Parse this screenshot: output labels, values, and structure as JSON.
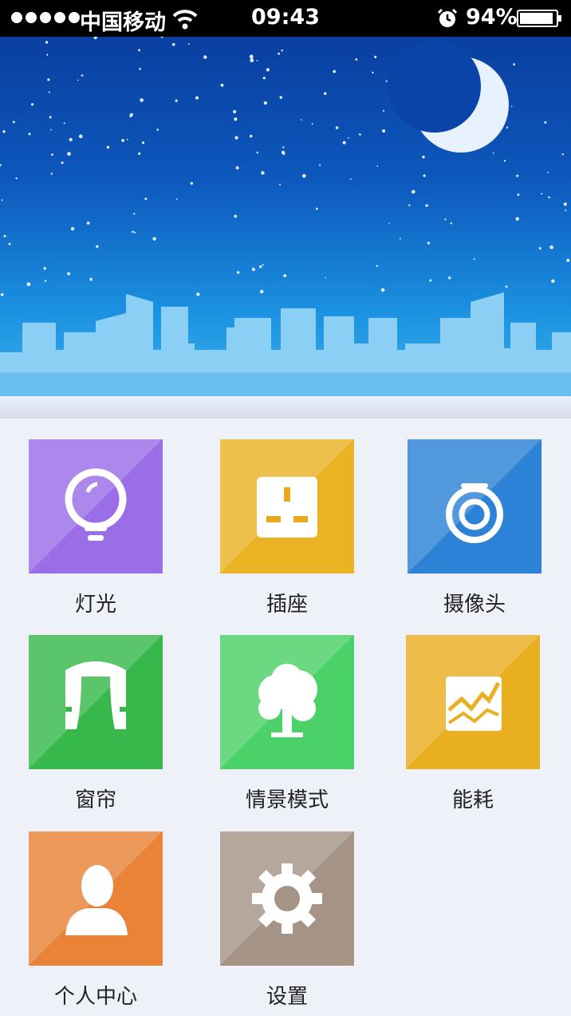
{
  "status_bar": {
    "carrier": "中国移动",
    "time": "09:43",
    "battery": "94%",
    "battery_level": 0.94
  },
  "tiles": [
    {
      "label": "灯光",
      "color": "#9b6ee8",
      "icon": "lightbulb-icon"
    },
    {
      "label": "插座",
      "color": "#eab324",
      "icon": "socket-icon"
    },
    {
      "label": "摄像头",
      "color": "#2b82d6",
      "icon": "camera-icon"
    },
    {
      "label": "窗帘",
      "color": "#36b84a",
      "icon": "curtain-icon"
    },
    {
      "label": "情景模式",
      "color": "#4ad167",
      "icon": "tree-icon"
    },
    {
      "label": "能耗",
      "color": "#e8af20",
      "icon": "energy-chart-icon"
    },
    {
      "label": "个人中心",
      "color": "#ea8338",
      "icon": "person-icon"
    },
    {
      "label": "设置",
      "color": "#a59486",
      "icon": "gear-icon"
    }
  ]
}
